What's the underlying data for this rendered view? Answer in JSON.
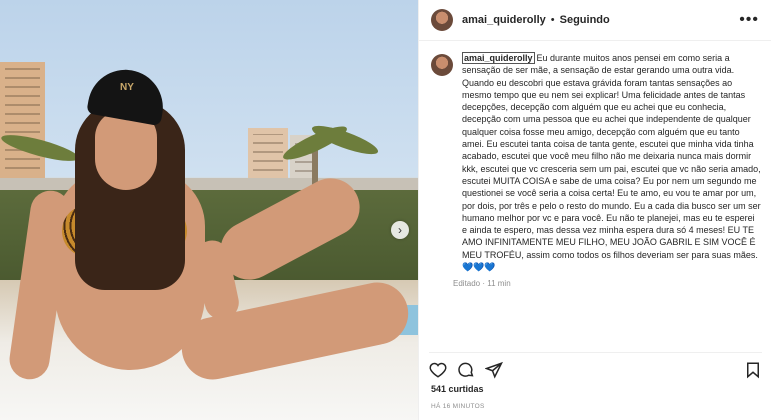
{
  "header": {
    "username": "amai_quiderolly",
    "separator": "•",
    "follow_status": "Seguindo",
    "more_icon": "more-horizontal-icon"
  },
  "caption": {
    "username": "amai_quiderolly",
    "text": "Eu durante muitos anos pensei em como seria a sensação de ser mãe, a sensação de estar gerando uma outra vida. Quando eu descobri que estava grávida foram tantas sensações ao mesmo tempo que eu nem sei explicar! Uma felicidade antes de tantas decepções, decepção com alguém que eu achei que eu conhecia, decepção com uma pessoa que eu achei que independente de qualquer qualquer coisa fosse meu amigo, decepção com alguém que eu tanto amei. Eu escutei tanta coisa de tanta gente, escutei que minha vida tinha acabado, escutei que você meu filho não me deixaria nunca mais dormir kkk, escutei que vc cresceria sem um pai, escutei que vc não seria amado, escutei MUITA COISA e sabe de uma coisa? Eu por nem um segundo me questionei se você seria a coisa certa! Eu te amo, eu vou te amar por um, por dois, por três e pelo o resto do mundo. Eu a cada dia busco ser um ser humano melhor por vc e para você. Eu não te planejei, mas eu te esperei e ainda te espero, mas dessa vez minha espera dura só 4 meses! EU TE AMO INFINITAMENTE MEU FILHO, MEU JOÃO GABRIL E SIM VOCÊ É MEU TROFÉU, assim como todos os filhos deveriam ser para suas mães. 💙💙💙",
    "meta": "Editado · 11 min"
  },
  "actions": {
    "like_icon": "heart-icon",
    "comment_icon": "comment-icon",
    "share_icon": "send-icon",
    "save_icon": "bookmark-icon"
  },
  "likes": "541 curtidas",
  "time_ago": "HÁ 16 MINUTOS",
  "carousel": {
    "next_icon": "chevron-right-icon",
    "next_glyph": "›"
  }
}
